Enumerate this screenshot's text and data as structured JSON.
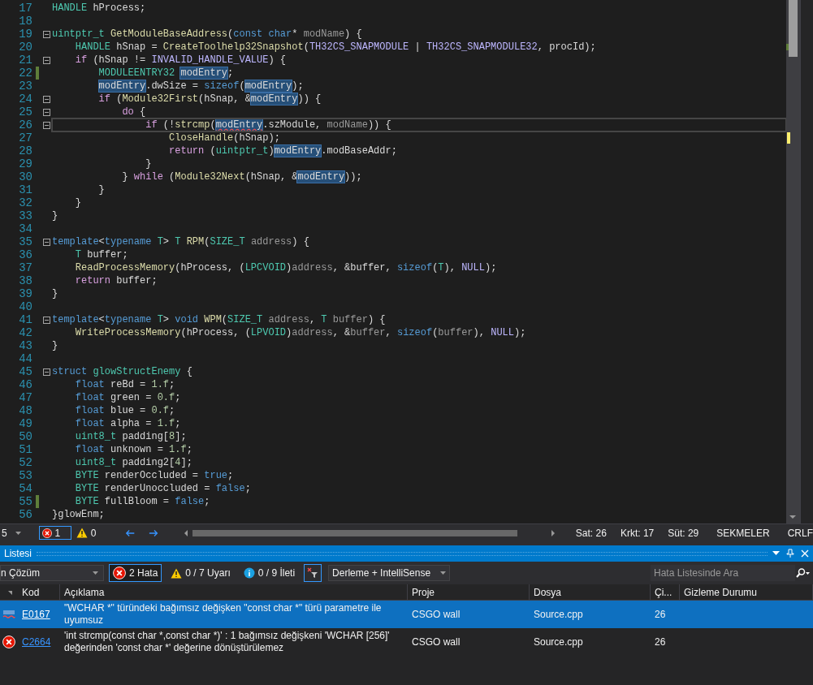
{
  "editor": {
    "lines": [
      {
        "number": "17",
        "tokens": [
          {
            "text": "HANDLE",
            "kind": "type"
          },
          {
            "text": " hProcess;",
            "kind": "plain"
          }
        ]
      },
      {
        "number": "18"
      },
      {
        "number": "19",
        "fold": true,
        "tokens": [
          {
            "text": "uintptr_t",
            "kind": "type"
          },
          {
            "text": " GetModuleBaseAddress",
            "kind": "func"
          },
          {
            "text": "(",
            "kind": "plain"
          },
          {
            "text": "const",
            "kind": "keyword"
          },
          {
            "text": " char",
            "kind": "keyword"
          },
          {
            "text": "* ",
            "kind": "plain"
          },
          {
            "text": "modName",
            "kind": "param"
          },
          {
            "text": ") {",
            "kind": "plain"
          }
        ]
      },
      {
        "number": "20",
        "tokens": [
          {
            "text": "    HANDLE",
            "kind": "type"
          },
          {
            "text": " hSnap = ",
            "kind": "plain"
          },
          {
            "text": "CreateToolhelp32Snapshot",
            "kind": "func"
          },
          {
            "text": "(",
            "kind": "plain"
          },
          {
            "text": "TH32CS_SNAPMODULE",
            "kind": "macro"
          },
          {
            "text": " | ",
            "kind": "plain"
          },
          {
            "text": "TH32CS_SNAPMODULE32",
            "kind": "macro"
          },
          {
            "text": ", procId);",
            "kind": "plain"
          }
        ]
      },
      {
        "number": "21",
        "fold": true,
        "tokens": [
          {
            "text": "    if",
            "kind": "control"
          },
          {
            "text": " (hSnap != ",
            "kind": "plain"
          },
          {
            "text": "INVALID_HANDLE_VALUE",
            "kind": "macro"
          },
          {
            "text": ") {",
            "kind": "plain"
          }
        ]
      },
      {
        "number": "22",
        "changed": true,
        "tokens": [
          {
            "text": "        MODULEENTRY32",
            "kind": "type"
          },
          {
            "text": " modEntry",
            "kind": "reference"
          },
          {
            "text": ";",
            "kind": "plain"
          }
        ]
      },
      {
        "number": "23",
        "tokens": [
          {
            "text": "        modEntry",
            "kind": "reference"
          },
          {
            "text": ".dwSize = ",
            "kind": "plain"
          },
          {
            "text": "sizeof",
            "kind": "keyword"
          },
          {
            "text": "(",
            "kind": "plain"
          },
          {
            "text": "modEntry",
            "kind": "reference"
          },
          {
            "text": ");",
            "kind": "plain"
          }
        ]
      },
      {
        "number": "24",
        "fold": true,
        "tokens": [
          {
            "text": "        if",
            "kind": "control"
          },
          {
            "text": " (",
            "kind": "plain"
          },
          {
            "text": "Module32First",
            "kind": "func"
          },
          {
            "text": "(hSnap, &",
            "kind": "plain"
          },
          {
            "text": "modEntry",
            "kind": "reference"
          },
          {
            "text": ")) {",
            "kind": "plain"
          }
        ]
      },
      {
        "number": "25",
        "fold": true,
        "tokens": [
          {
            "text": "            do",
            "kind": "control"
          },
          {
            "text": " {",
            "kind": "plain"
          }
        ]
      },
      {
        "number": "26",
        "fold": true,
        "current": true,
        "tokens": [
          {
            "text": "                if",
            "kind": "control"
          },
          {
            "text": " (!",
            "kind": "plain"
          },
          {
            "text": "strcmp",
            "kind": "func"
          },
          {
            "text": "(",
            "kind": "plain"
          },
          {
            "text": "modEntry",
            "kind": "reference_error"
          },
          {
            "text": ".szModule, ",
            "kind": "plain"
          },
          {
            "text": "modName",
            "kind": "param"
          },
          {
            "text": ")) {",
            "kind": "plain"
          }
        ]
      },
      {
        "number": "27",
        "tokens": [
          {
            "text": "                    CloseHandle",
            "kind": "func"
          },
          {
            "text": "(hSnap);",
            "kind": "plain"
          }
        ]
      },
      {
        "number": "28",
        "tokens": [
          {
            "text": "                    return",
            "kind": "control"
          },
          {
            "text": " (",
            "kind": "plain"
          },
          {
            "text": "uintptr_t",
            "kind": "type"
          },
          {
            "text": ")",
            "kind": "plain"
          },
          {
            "text": "modEntry",
            "kind": "reference"
          },
          {
            "text": ".modBaseAddr;",
            "kind": "plain"
          }
        ]
      },
      {
        "number": "29",
        "tokens": [
          {
            "text": "                }",
            "kind": "plain"
          }
        ]
      },
      {
        "number": "30",
        "tokens": [
          {
            "text": "            } ",
            "kind": "plain"
          },
          {
            "text": "while",
            "kind": "control"
          },
          {
            "text": " (",
            "kind": "plain"
          },
          {
            "text": "Module32Next",
            "kind": "func"
          },
          {
            "text": "(hSnap, &",
            "kind": "plain"
          },
          {
            "text": "modEntry",
            "kind": "reference"
          },
          {
            "text": "));",
            "kind": "plain"
          }
        ]
      },
      {
        "number": "31",
        "tokens": [
          {
            "text": "        }",
            "kind": "plain"
          }
        ]
      },
      {
        "number": "32",
        "tokens": [
          {
            "text": "    }",
            "kind": "plain"
          }
        ]
      },
      {
        "number": "33",
        "tokens": [
          {
            "text": "}",
            "kind": "plain"
          }
        ]
      },
      {
        "number": "34"
      },
      {
        "number": "35",
        "fold": true,
        "tokens": [
          {
            "text": "template",
            "kind": "keyword"
          },
          {
            "text": "<",
            "kind": "plain"
          },
          {
            "text": "typename",
            "kind": "keyword"
          },
          {
            "text": " T",
            "kind": "type"
          },
          {
            "text": "> ",
            "kind": "plain"
          },
          {
            "text": "T",
            "kind": "type"
          },
          {
            "text": " RPM",
            "kind": "func"
          },
          {
            "text": "(",
            "kind": "plain"
          },
          {
            "text": "SIZE_T",
            "kind": "type"
          },
          {
            "text": " address",
            "kind": "param"
          },
          {
            "text": ") {",
            "kind": "plain"
          }
        ]
      },
      {
        "number": "36",
        "tokens": [
          {
            "text": "    T",
            "kind": "type"
          },
          {
            "text": " buffer;",
            "kind": "plain"
          }
        ]
      },
      {
        "number": "37",
        "tokens": [
          {
            "text": "    ReadProcessMemory",
            "kind": "func"
          },
          {
            "text": "(hProcess, (",
            "kind": "plain"
          },
          {
            "text": "LPCVOID",
            "kind": "type"
          },
          {
            "text": ")",
            "kind": "plain"
          },
          {
            "text": "address",
            "kind": "param"
          },
          {
            "text": ", &buffer, ",
            "kind": "plain"
          },
          {
            "text": "sizeof",
            "kind": "keyword"
          },
          {
            "text": "(",
            "kind": "plain"
          },
          {
            "text": "T",
            "kind": "type"
          },
          {
            "text": "), ",
            "kind": "plain"
          },
          {
            "text": "NULL",
            "kind": "macro"
          },
          {
            "text": ");",
            "kind": "plain"
          }
        ]
      },
      {
        "number": "38",
        "tokens": [
          {
            "text": "    return",
            "kind": "control"
          },
          {
            "text": " buffer;",
            "kind": "plain"
          }
        ]
      },
      {
        "number": "39",
        "tokens": [
          {
            "text": "}",
            "kind": "plain"
          }
        ]
      },
      {
        "number": "40"
      },
      {
        "number": "41",
        "fold": true,
        "tokens": [
          {
            "text": "template",
            "kind": "keyword"
          },
          {
            "text": "<",
            "kind": "plain"
          },
          {
            "text": "typename",
            "kind": "keyword"
          },
          {
            "text": " T",
            "kind": "type"
          },
          {
            "text": "> ",
            "kind": "plain"
          },
          {
            "text": "void",
            "kind": "keyword"
          },
          {
            "text": " WPM",
            "kind": "func"
          },
          {
            "text": "(",
            "kind": "plain"
          },
          {
            "text": "SIZE_T",
            "kind": "type"
          },
          {
            "text": " address",
            "kind": "param"
          },
          {
            "text": ", ",
            "kind": "plain"
          },
          {
            "text": "T",
            "kind": "type"
          },
          {
            "text": " buffer",
            "kind": "param"
          },
          {
            "text": ") {",
            "kind": "plain"
          }
        ]
      },
      {
        "number": "42",
        "tokens": [
          {
            "text": "    WriteProcessMemory",
            "kind": "func"
          },
          {
            "text": "(hProcess, (",
            "kind": "plain"
          },
          {
            "text": "LPVOID",
            "kind": "type"
          },
          {
            "text": ")",
            "kind": "plain"
          },
          {
            "text": "address",
            "kind": "param"
          },
          {
            "text": ", &",
            "kind": "plain"
          },
          {
            "text": "buffer",
            "kind": "param"
          },
          {
            "text": ", ",
            "kind": "plain"
          },
          {
            "text": "sizeof",
            "kind": "keyword"
          },
          {
            "text": "(",
            "kind": "plain"
          },
          {
            "text": "buffer",
            "kind": "param"
          },
          {
            "text": "), ",
            "kind": "plain"
          },
          {
            "text": "NULL",
            "kind": "macro"
          },
          {
            "text": ");",
            "kind": "plain"
          }
        ]
      },
      {
        "number": "43",
        "tokens": [
          {
            "text": "}",
            "kind": "plain"
          }
        ]
      },
      {
        "number": "44"
      },
      {
        "number": "45",
        "fold": true,
        "tokens": [
          {
            "text": "struct",
            "kind": "keyword"
          },
          {
            "text": " glowStructEnemy",
            "kind": "type"
          },
          {
            "text": " {",
            "kind": "plain"
          }
        ]
      },
      {
        "number": "46",
        "tokens": [
          {
            "text": "    float",
            "kind": "keyword"
          },
          {
            "text": " reBd = ",
            "kind": "plain"
          },
          {
            "text": "1.f",
            "kind": "number"
          },
          {
            "text": ";",
            "kind": "plain"
          }
        ]
      },
      {
        "number": "47",
        "tokens": [
          {
            "text": "    float",
            "kind": "keyword"
          },
          {
            "text": " green = ",
            "kind": "plain"
          },
          {
            "text": "0.f",
            "kind": "number"
          },
          {
            "text": ";",
            "kind": "plain"
          }
        ]
      },
      {
        "number": "48",
        "tokens": [
          {
            "text": "    float",
            "kind": "keyword"
          },
          {
            "text": " blue = ",
            "kind": "plain"
          },
          {
            "text": "0.f",
            "kind": "number"
          },
          {
            "text": ";",
            "kind": "plain"
          }
        ]
      },
      {
        "number": "49",
        "tokens": [
          {
            "text": "    float",
            "kind": "keyword"
          },
          {
            "text": " alpha = ",
            "kind": "plain"
          },
          {
            "text": "1.f",
            "kind": "number"
          },
          {
            "text": ";",
            "kind": "plain"
          }
        ]
      },
      {
        "number": "50",
        "tokens": [
          {
            "text": "    uint8_t",
            "kind": "type"
          },
          {
            "text": " padding[",
            "kind": "plain"
          },
          {
            "text": "8",
            "kind": "number"
          },
          {
            "text": "];",
            "kind": "plain"
          }
        ]
      },
      {
        "number": "51",
        "tokens": [
          {
            "text": "    float",
            "kind": "keyword"
          },
          {
            "text": " unknown = ",
            "kind": "plain"
          },
          {
            "text": "1.f",
            "kind": "number"
          },
          {
            "text": ";",
            "kind": "plain"
          }
        ]
      },
      {
        "number": "52",
        "tokens": [
          {
            "text": "    uint8_t",
            "kind": "type"
          },
          {
            "text": " padding2[",
            "kind": "plain"
          },
          {
            "text": "4",
            "kind": "number"
          },
          {
            "text": "];",
            "kind": "plain"
          }
        ]
      },
      {
        "number": "53",
        "tokens": [
          {
            "text": "    BYTE",
            "kind": "type"
          },
          {
            "text": " renderOccluded = ",
            "kind": "plain"
          },
          {
            "text": "true",
            "kind": "keyword"
          },
          {
            "text": ";",
            "kind": "plain"
          }
        ]
      },
      {
        "number": "54",
        "tokens": [
          {
            "text": "    BYTE",
            "kind": "type"
          },
          {
            "text": " renderUnoccluded = ",
            "kind": "plain"
          },
          {
            "text": "false",
            "kind": "keyword"
          },
          {
            "text": ";",
            "kind": "plain"
          }
        ]
      },
      {
        "number": "55",
        "changed": true,
        "tokens": [
          {
            "text": "    BYTE",
            "kind": "type"
          },
          {
            "text": " fullBloom = ",
            "kind": "plain"
          },
          {
            "text": "false",
            "kind": "keyword"
          },
          {
            "text": ";",
            "kind": "plain"
          }
        ]
      },
      {
        "number": "56",
        "tokens": [
          {
            "text": "}glowEnm;",
            "kind": "plain"
          }
        ]
      }
    ]
  },
  "status_bar": {
    "zoom": "5",
    "errors": "1",
    "warnings": "0",
    "line": "Sat: 26",
    "char": "Krkt: 17",
    "column": "Süt: 29",
    "indent": "SEKMELER",
    "line_ending": "CRLF"
  },
  "error_list": {
    "title": "Listesi",
    "scope": "n Çözüm",
    "filters": [
      {
        "kind": "error",
        "label": "2 Hata",
        "selected": true
      },
      {
        "kind": "warning",
        "label": "0 / 7 Uyarı",
        "selected": false
      },
      {
        "kind": "message",
        "label": "0 / 9 İleti",
        "selected": false
      }
    ],
    "source": "Derleme + IntelliSense",
    "search": {
      "placeholder": "Hata Listesinde Ara"
    },
    "columns": [
      "Kod",
      "Açıklama",
      "Proje",
      "Dosya",
      "Çi...",
      "Gizleme Durumu"
    ],
    "rows": [
      {
        "kind": "spelling",
        "selected": true,
        "code": "E0167",
        "description": "\"WCHAR *\" türündeki bağımsız değişken \"const char *\" türü parametre ile uyumsuz",
        "project": "CSGO wall",
        "file": "Source.cpp",
        "line": "26"
      },
      {
        "kind": "error",
        "selected": false,
        "code": "C2664",
        "description": "'int strcmp(const char *,const char *)' : 1 bağımsız değişkeni 'WCHAR [256]' değerinden 'const char *' değerine dönüştürülemez",
        "project": "CSGO wall",
        "file": "Source.cpp",
        "line": "26"
      }
    ]
  }
}
